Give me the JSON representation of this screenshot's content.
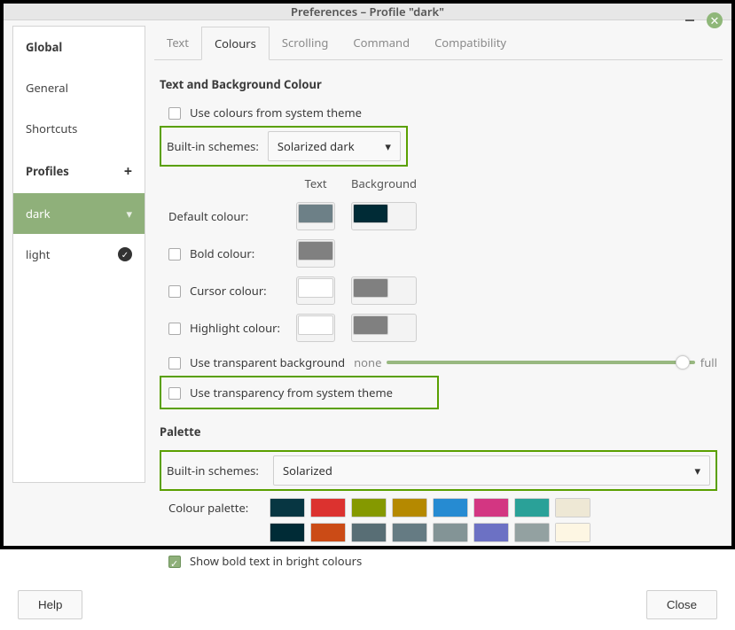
{
  "window": {
    "title": "Preferences – Profile \"dark\""
  },
  "sidebar": {
    "global": "Global",
    "items": [
      "General",
      "Shortcuts"
    ],
    "profiles": "Profiles",
    "profile_list": [
      {
        "name": "dark",
        "active": true,
        "default": false
      },
      {
        "name": "light",
        "active": false,
        "default": true
      }
    ]
  },
  "tabs": [
    "Text",
    "Colours",
    "Scrolling",
    "Command",
    "Compatibility"
  ],
  "active_tab": "Colours",
  "colours": {
    "section1_title": "Text and Background Colour",
    "use_system_theme": {
      "label": "Use colours from system theme",
      "checked": false
    },
    "builtin_schemes_label": "Built-in schemes:",
    "builtin_scheme_value": "Solarized dark",
    "grid": {
      "text_hdr": "Text",
      "bg_hdr": "Background",
      "default_label": "Default colour:",
      "bold_label": "Bold colour:",
      "cursor_label": "Cursor colour:",
      "hl_label": "Highlight colour:",
      "default": {
        "text": "#6d8087",
        "bg": "#002b36"
      },
      "bold": {
        "checked": false,
        "text": "#808080"
      },
      "cursor": {
        "checked": false,
        "text": "#ffffff",
        "bg": "#808080"
      },
      "hl": {
        "checked": false,
        "text": "#ffffff",
        "bg": "#808080"
      }
    },
    "transparent_bg": {
      "label": "Use transparent background",
      "checked": false,
      "none": "none",
      "full": "full"
    },
    "transparency_theme": {
      "label": "Use transparency from system theme",
      "checked": false
    }
  },
  "palette": {
    "title": "Palette",
    "builtin_schemes_label": "Built-in schemes:",
    "builtin_scheme_value": "Solarized",
    "palette_label": "Colour palette:",
    "cells_row1": [
      "#073642",
      "#dc322f",
      "#859900",
      "#b58900",
      "#268bd2",
      "#d33682",
      "#2aa198",
      "#eee8d5"
    ],
    "cells_row2": [
      "#002b36",
      "#cb4b16",
      "#586e75",
      "#657b83",
      "#839496",
      "#6c71c4",
      "#93a1a1",
      "#fdf6e3"
    ],
    "show_bold": {
      "label": "Show bold text in bright colours",
      "checked": true
    }
  },
  "footer": {
    "help": "Help",
    "close": "Close"
  }
}
